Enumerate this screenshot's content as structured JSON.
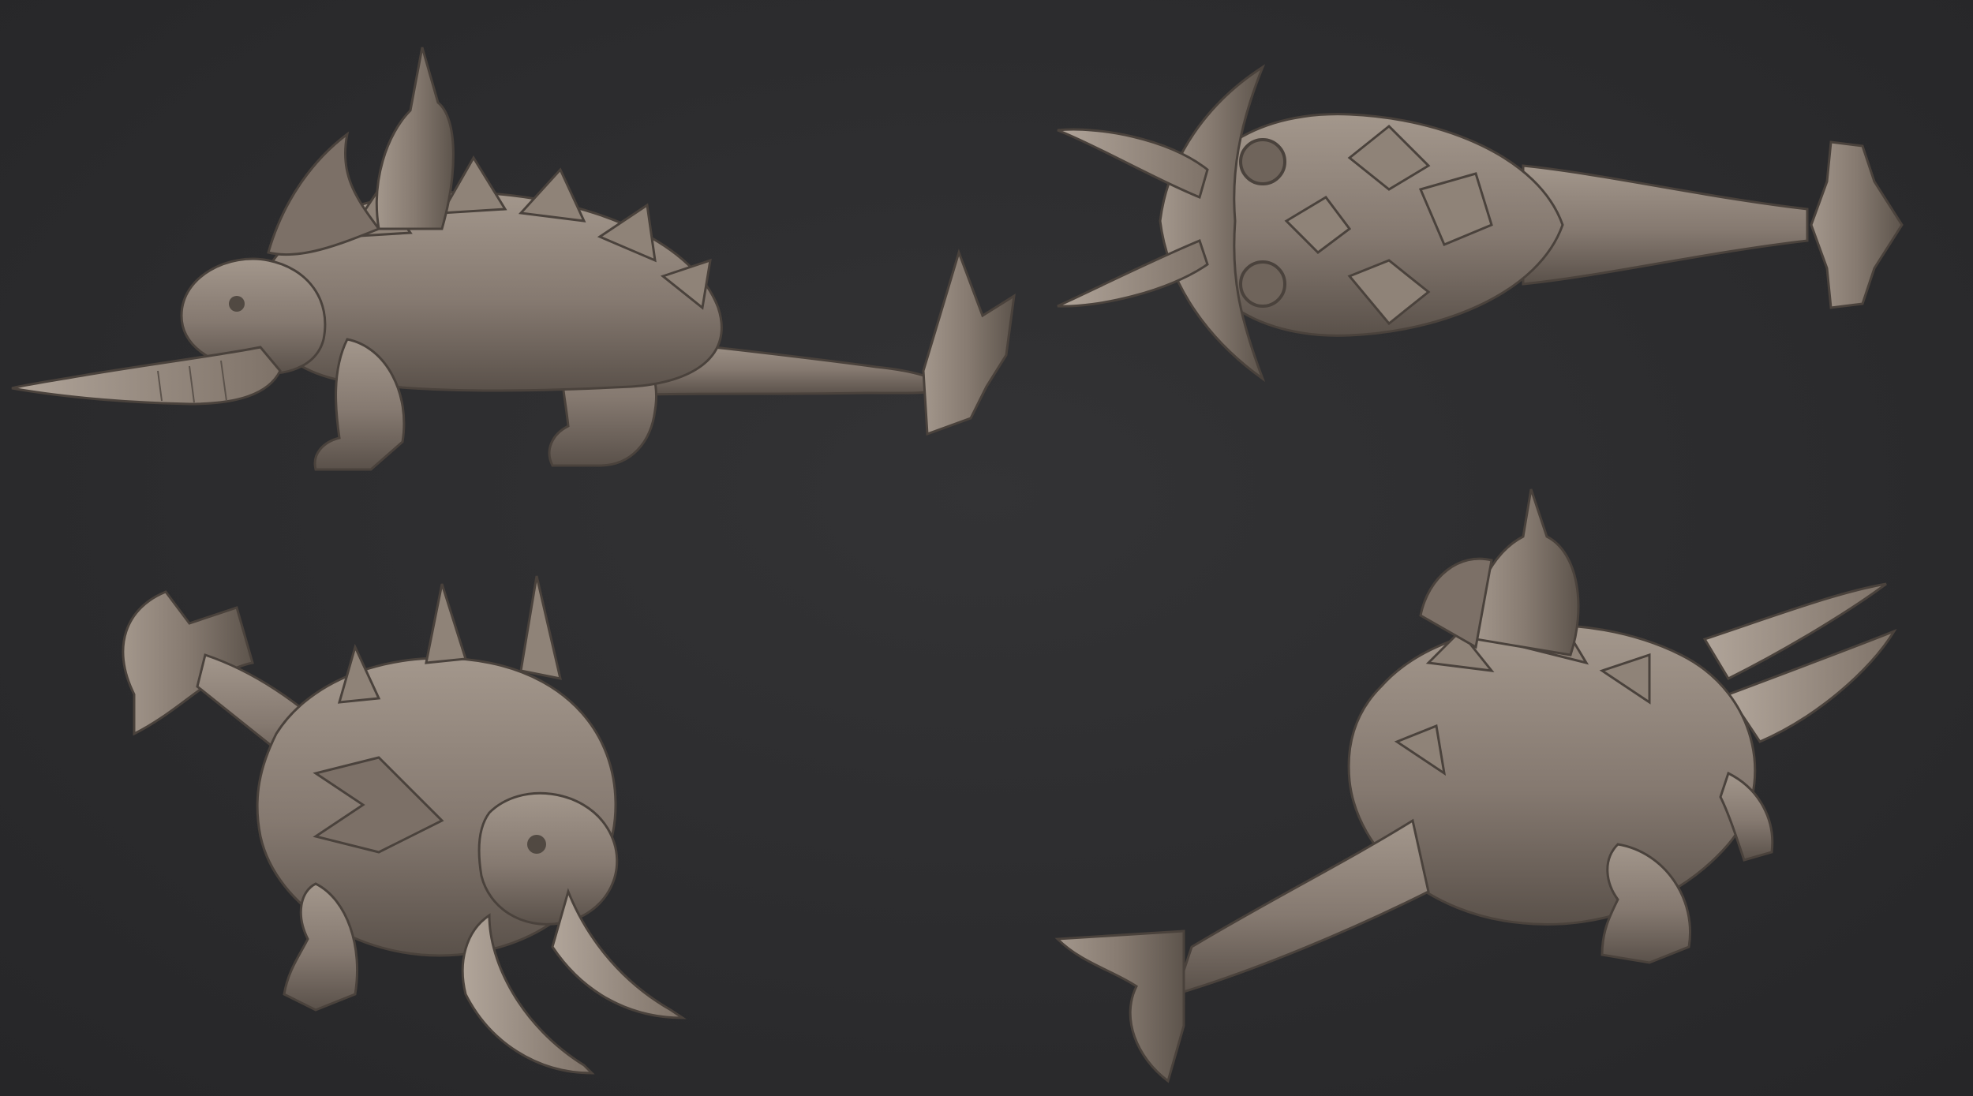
{
  "scene": {
    "background_color": "#2b2b2d",
    "clay_color": "#857970",
    "clay_light": "#a1958a",
    "clay_dark": "#4f4741",
    "views": [
      {
        "id": "view-side",
        "name": "side-view",
        "subject": "creature-sculpt-side"
      },
      {
        "id": "view-top",
        "name": "top-view",
        "subject": "creature-sculpt-top"
      },
      {
        "id": "view-front",
        "name": "front-three-quarter-view",
        "subject": "creature-sculpt-front"
      },
      {
        "id": "view-back",
        "name": "back-three-quarter-view",
        "subject": "creature-sculpt-back"
      }
    ]
  }
}
